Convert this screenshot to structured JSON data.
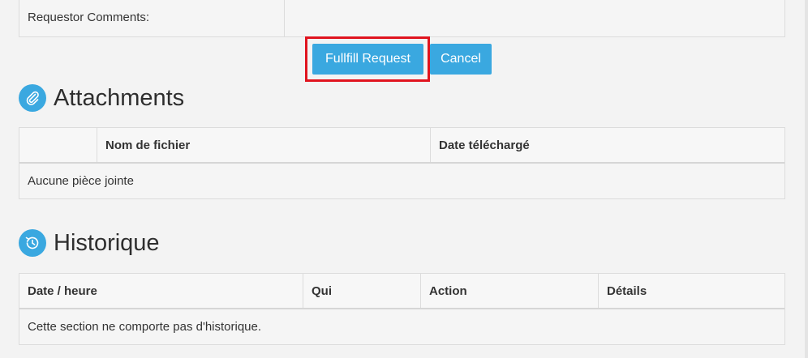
{
  "requestor_comments": {
    "label": "Requestor Comments:",
    "value": ""
  },
  "buttons": {
    "fulfill_label": "Fullfill Request",
    "cancel_label": "Cancel"
  },
  "attachments": {
    "title": "Attachments",
    "icon": "paperclip-icon",
    "columns": [
      "",
      "Nom de fichier",
      "Date téléchargé"
    ],
    "empty_text": "Aucune pièce jointe"
  },
  "history": {
    "title": "Historique",
    "icon": "history-clock-icon",
    "columns": [
      "Date / heure",
      "Qui",
      "Action",
      "Détails"
    ],
    "empty_text": "Cette section ne comporte pas d'historique."
  },
  "colors": {
    "accent": "#3aa8e0",
    "highlight": "#e0141e",
    "background": "#f3f3f3"
  }
}
